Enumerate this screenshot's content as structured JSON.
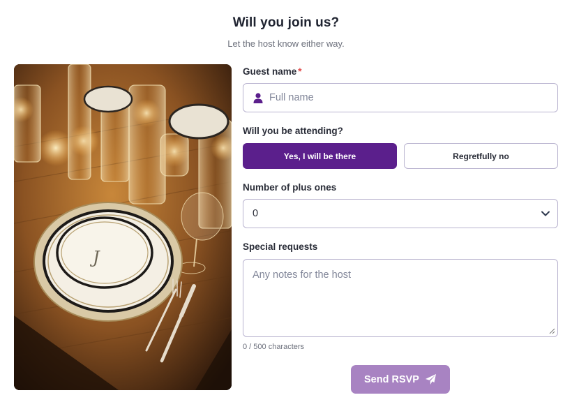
{
  "header": {
    "title": "Will you join us?",
    "subtitle": "Let the host know either way."
  },
  "form": {
    "guest_name": {
      "label": "Guest name",
      "required_marker": "*",
      "placeholder": "Full name",
      "icon": "person-icon"
    },
    "attending": {
      "label": "Will you be attending?",
      "options": [
        "Yes, I will be there",
        "Regretfully no"
      ],
      "selected": "Yes, I will be there"
    },
    "plus_ones": {
      "label": "Number of plus ones",
      "value": "0",
      "icon": "chevron-down-icon"
    },
    "special_requests": {
      "label": "Special requests",
      "placeholder": "Any notes for the host",
      "counter": "0 / 500 characters"
    },
    "submit": {
      "label": "Send RSVP",
      "icon": "paper-plane-icon"
    }
  },
  "colors": {
    "accent": "#5b1f8c",
    "submit_disabled": "#a883c2",
    "border": "#b9b3cf",
    "required": "#e04848"
  }
}
